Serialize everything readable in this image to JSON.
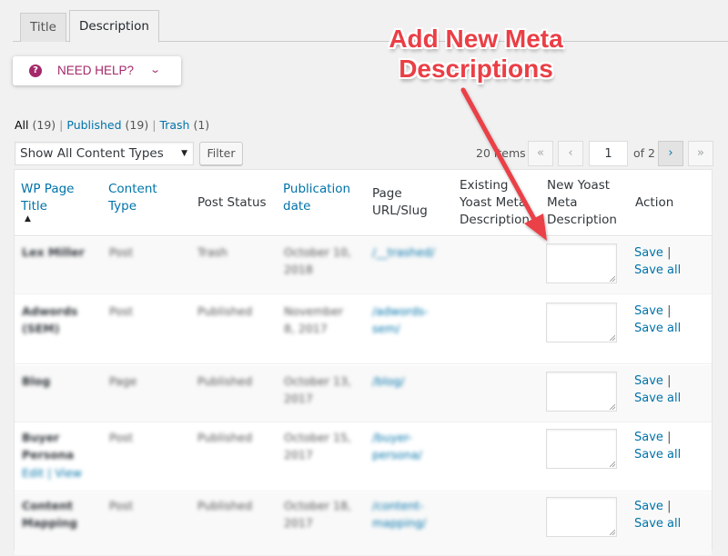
{
  "tabs": [
    {
      "label": "Title",
      "active": false
    },
    {
      "label": "Description",
      "active": true
    }
  ],
  "help": {
    "icon": "question-circle-icon",
    "label": "NEED HELP?",
    "chevron": "chevron-down-icon"
  },
  "status_filters": {
    "all": {
      "label": "All",
      "count": "(19)"
    },
    "published": {
      "label": "Published",
      "count": "(19)"
    },
    "trash": {
      "label": "Trash",
      "count": "(1)"
    },
    "separator": "|"
  },
  "filter": {
    "select_value": "Show All Content Types",
    "button_label": "Filter"
  },
  "pagination": {
    "items": "20 items",
    "first": "«",
    "prev": "‹",
    "current_page": "1",
    "of_pages": "of 2",
    "next": "›",
    "last": "»"
  },
  "columns": [
    {
      "label": "WP Page Title",
      "sortable": true,
      "sorted": "asc"
    },
    {
      "label": "Content Type",
      "sortable": true
    },
    {
      "label": "Post Status",
      "sortable": false
    },
    {
      "label": "Publication date",
      "sortable": true
    },
    {
      "label": "Page URL/Slug",
      "sortable": false
    },
    {
      "label": "Existing Yoast Meta Description",
      "sortable": false
    },
    {
      "label": "New Yoast Meta Description",
      "sortable": false
    },
    {
      "label": "Action",
      "sortable": false
    }
  ],
  "sort_indicator": "▲",
  "rows": [
    {
      "title": "Lex Miller",
      "type": "Post",
      "status": "Trash",
      "date": "October 10, 2018",
      "slug": "/__trashed/",
      "existing": "",
      "new_desc": "",
      "row_actions": ""
    },
    {
      "title": "Adwords (SEM)",
      "type": "Post",
      "status": "Published",
      "date": "November 8, 2017",
      "slug": "/adwords-sem/",
      "existing": "",
      "new_desc": "",
      "row_actions": ""
    },
    {
      "title": "Blog",
      "type": "Page",
      "status": "Published",
      "date": "October 13, 2017",
      "slug": "/blog/",
      "existing": "",
      "new_desc": "",
      "row_actions": ""
    },
    {
      "title": "Buyer Persona",
      "type": "Post",
      "status": "Published",
      "date": "October 15, 2017",
      "slug": "/buyer-persona/",
      "existing": "",
      "new_desc": "",
      "row_actions": "Edit | View"
    },
    {
      "title": "Content Mapping",
      "type": "Post",
      "status": "Published",
      "date": "October 18, 2017",
      "slug": "/content-mapping/",
      "existing": "",
      "new_desc": "",
      "row_actions": ""
    }
  ],
  "actions": {
    "save": "Save",
    "separator": "|",
    "save_all": "Save all"
  },
  "annotation": {
    "line1": "Add New Meta",
    "line2": "Descriptions",
    "color": "#ea3f46"
  }
}
